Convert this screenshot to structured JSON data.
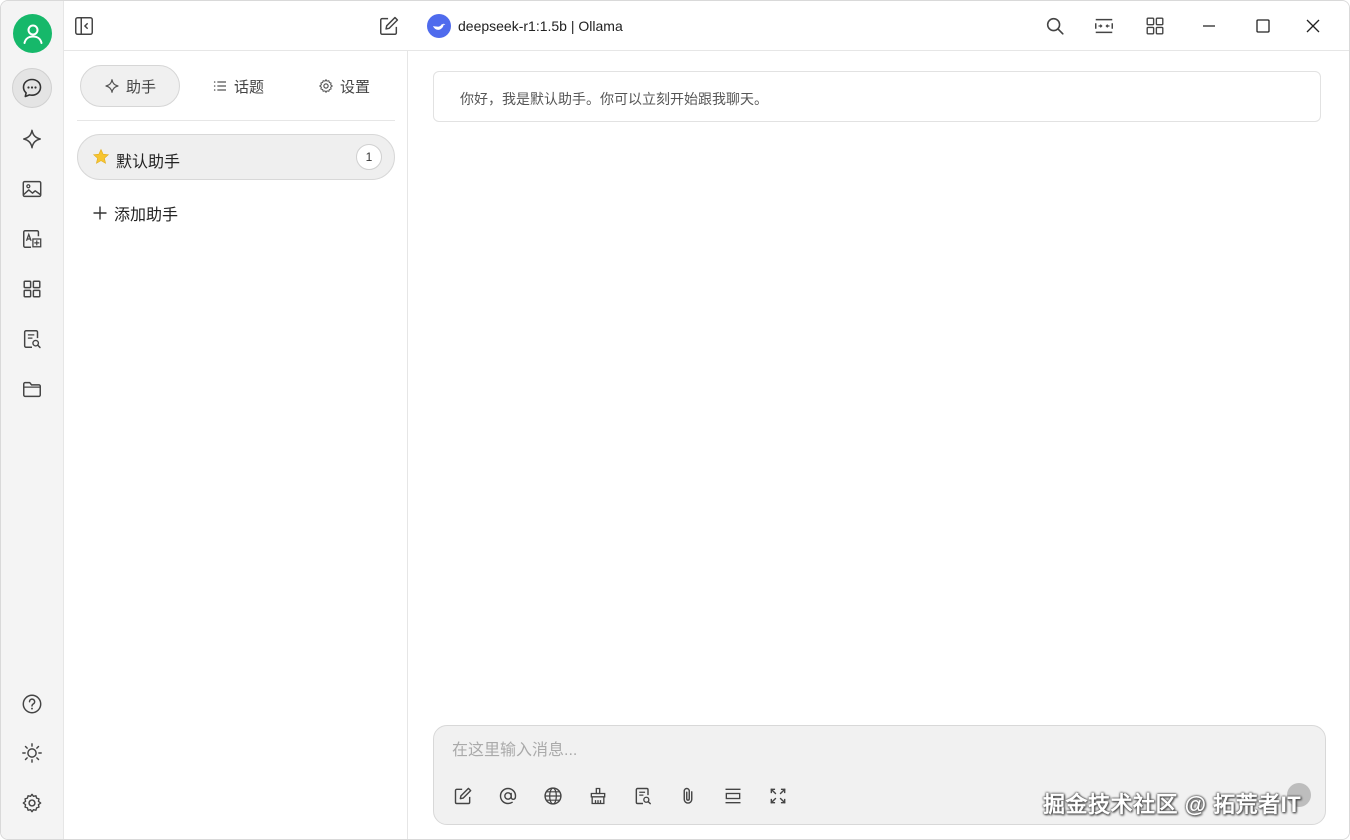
{
  "titlebar": {
    "model_title": "deepseek-r1:1.5b | Ollama"
  },
  "rail": {
    "items": [
      {
        "icon": "chat-bubble-icon",
        "active": true
      },
      {
        "icon": "sparkle-icon"
      },
      {
        "icon": "image-icon"
      },
      {
        "icon": "translate-icon"
      },
      {
        "icon": "apps-grid-icon"
      },
      {
        "icon": "knowledge-search-icon"
      },
      {
        "icon": "folder-icon"
      }
    ],
    "bottom": [
      {
        "icon": "help-icon"
      },
      {
        "icon": "theme-sun-icon"
      },
      {
        "icon": "settings-gear-icon"
      }
    ]
  },
  "panel": {
    "tabs": [
      {
        "label": "助手",
        "icon": "sparkle-icon",
        "active": true
      },
      {
        "label": "话题",
        "icon": "list-icon"
      },
      {
        "label": "设置",
        "icon": "gear-icon"
      }
    ],
    "assistant": {
      "name": "默认助手",
      "icon": "star-icon",
      "count": "1"
    },
    "add_label": "添加助手"
  },
  "chat": {
    "greeting": "你好，我是默认助手。你可以立刻开始跟我聊天。"
  },
  "input": {
    "placeholder": "在这里输入消息...",
    "tools": [
      "edit-icon",
      "mention-icon",
      "globe-icon",
      "clear-brush-icon",
      "knowledge-icon",
      "attach-icon",
      "divider-icon",
      "expand-icon"
    ]
  },
  "watermark": "掘金技术社区 @ 拓荒者IT",
  "colors": {
    "avatar": "#16b86a",
    "model_logo": "#4f6bed",
    "star": "#f7c531"
  }
}
